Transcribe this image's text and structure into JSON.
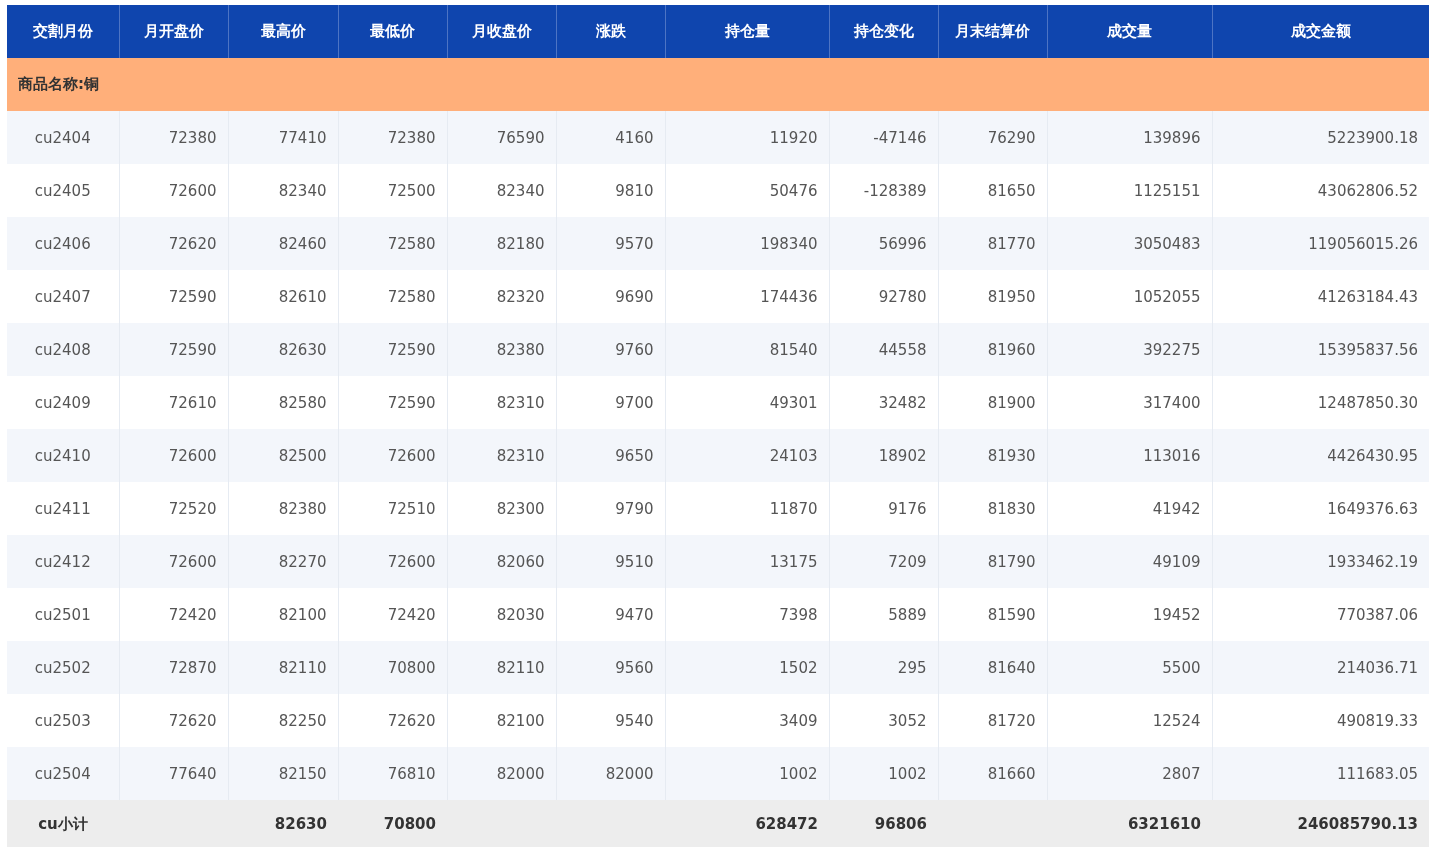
{
  "table": {
    "columns": [
      "交割月份",
      "月开盘价",
      "最高价",
      "最低价",
      "月收盘价",
      "涨跌",
      "持仓量",
      "持仓变化",
      "月末结算价",
      "成交量",
      "成交金额"
    ],
    "group": {
      "label": "商品名称:铜"
    },
    "rows": [
      [
        "cu2404",
        "72380",
        "77410",
        "72380",
        "76590",
        "4160",
        "11920",
        "-47146",
        "76290",
        "139896",
        "5223900.18"
      ],
      [
        "cu2405",
        "72600",
        "82340",
        "72500",
        "82340",
        "9810",
        "50476",
        "-128389",
        "81650",
        "1125151",
        "43062806.52"
      ],
      [
        "cu2406",
        "72620",
        "82460",
        "72580",
        "82180",
        "9570",
        "198340",
        "56996",
        "81770",
        "3050483",
        "119056015.26"
      ],
      [
        "cu2407",
        "72590",
        "82610",
        "72580",
        "82320",
        "9690",
        "174436",
        "92780",
        "81950",
        "1052055",
        "41263184.43"
      ],
      [
        "cu2408",
        "72590",
        "82630",
        "72590",
        "82380",
        "9760",
        "81540",
        "44558",
        "81960",
        "392275",
        "15395837.56"
      ],
      [
        "cu2409",
        "72610",
        "82580",
        "72590",
        "82310",
        "9700",
        "49301",
        "32482",
        "81900",
        "317400",
        "12487850.30"
      ],
      [
        "cu2410",
        "72600",
        "82500",
        "72600",
        "82310",
        "9650",
        "24103",
        "18902",
        "81930",
        "113016",
        "4426430.95"
      ],
      [
        "cu2411",
        "72520",
        "82380",
        "72510",
        "82300",
        "9790",
        "11870",
        "9176",
        "81830",
        "41942",
        "1649376.63"
      ],
      [
        "cu2412",
        "72600",
        "82270",
        "72600",
        "82060",
        "9510",
        "13175",
        "7209",
        "81790",
        "49109",
        "1933462.19"
      ],
      [
        "cu2501",
        "72420",
        "82100",
        "72420",
        "82030",
        "9470",
        "7398",
        "5889",
        "81590",
        "19452",
        "770387.06"
      ],
      [
        "cu2502",
        "72870",
        "82110",
        "70800",
        "82110",
        "9560",
        "1502",
        "295",
        "81640",
        "5500",
        "214036.71"
      ],
      [
        "cu2503",
        "72620",
        "82250",
        "72620",
        "82100",
        "9540",
        "3409",
        "3052",
        "81720",
        "12524",
        "490819.33"
      ],
      [
        "cu2504",
        "77640",
        "82150",
        "76810",
        "82000",
        "82000",
        "1002",
        "1002",
        "81660",
        "2807",
        "111683.05"
      ]
    ],
    "subtotal": [
      {
        "kind": "value",
        "text": "cu小计"
      },
      {
        "kind": "empty"
      },
      {
        "kind": "value",
        "text": "82630"
      },
      {
        "kind": "value",
        "text": "70800"
      },
      {
        "kind": "empty"
      },
      {
        "kind": "empty"
      },
      {
        "kind": "value",
        "text": "628472"
      },
      {
        "kind": "value",
        "text": "96806"
      },
      {
        "kind": "empty"
      },
      {
        "kind": "value",
        "text": "6321610"
      },
      {
        "kind": "value",
        "text": "246085790.13"
      }
    ]
  }
}
